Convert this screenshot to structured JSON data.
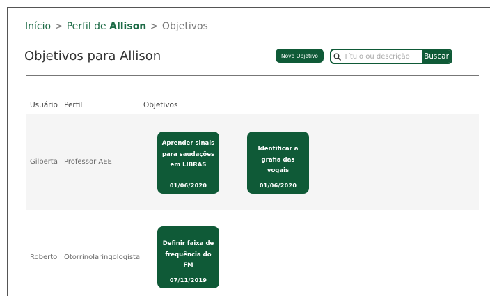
{
  "breadcrumb": {
    "home": "Início",
    "separator1": ">",
    "profile_prefix": "Perfil de",
    "profile_name": "Allison",
    "separator2": ">",
    "current": "Objetivos"
  },
  "page": {
    "title": "Objetivos para Allison"
  },
  "toolbar": {
    "new_label": "Novo Objetivo",
    "search_placeholder": "Título ou descrição",
    "search_value": "",
    "search_button": "Buscar"
  },
  "table": {
    "headers": [
      "Usuário",
      "Perfil",
      "Objetivos"
    ],
    "rows": [
      {
        "user": "Gilberta",
        "profile": "Professor AEE",
        "objectives": [
          {
            "title": "Aprender sinais para saudações em LIBRAS",
            "date": "01/06/2020"
          },
          {
            "title": "Identificar a grafia das vogais",
            "date": "01/06/2020"
          }
        ]
      },
      {
        "user": "Roberto",
        "profile": "Otorrinolaringologista",
        "objectives": [
          {
            "title": "Definir faixa de frequência do FM",
            "date": "07/11/2019"
          }
        ]
      }
    ]
  },
  "colors": {
    "brand": "#0f5a37",
    "link": "#1d6b46",
    "row_alt": "#f5f5f5"
  },
  "icons": {
    "search": "magnifier-icon"
  }
}
